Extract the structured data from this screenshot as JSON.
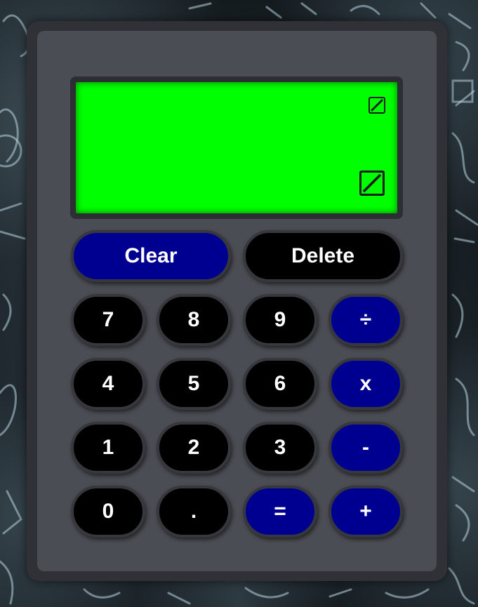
{
  "display": {
    "top_placeholder": "missing-glyph-icon",
    "bottom_placeholder": "missing-glyph-icon",
    "screen_color": "#00ff00"
  },
  "controls": {
    "clear_label": "Clear",
    "delete_label": "Delete"
  },
  "keys": {
    "seven": "7",
    "eight": "8",
    "nine": "9",
    "divide": "÷",
    "four": "4",
    "five": "5",
    "six": "6",
    "multiply": "x",
    "one": "1",
    "two": "2",
    "three": "3",
    "subtract": "-",
    "zero": "0",
    "decimal": ".",
    "equals": "=",
    "add": "+"
  },
  "colors": {
    "operator_button": "#000090",
    "digit_button": "#000000",
    "panel": "#4a4d53"
  }
}
